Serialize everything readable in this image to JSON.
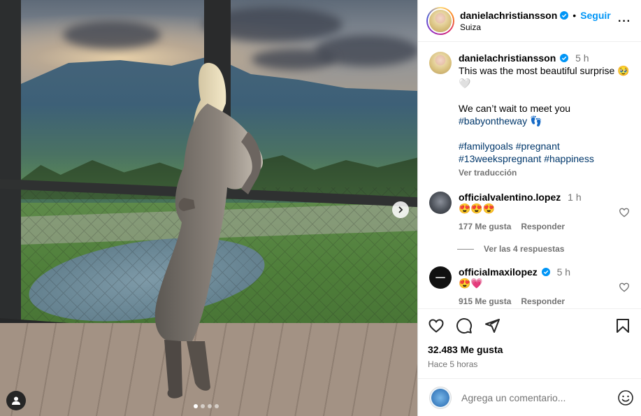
{
  "post": {
    "image_alt": "",
    "carousel_dots": 4,
    "active_dot": 0
  },
  "header": {
    "username": "danielachristiansson",
    "verified": true,
    "follow_label": "Seguir",
    "location": "Suiza",
    "more_icon": "more-horizontal-icon"
  },
  "caption": {
    "username": "danielachristiansson",
    "time": "5 h",
    "line1": "This was the most beautiful surprise 🥹",
    "line2": "🤍",
    "line3": "We can’t wait to meet you",
    "tag_line4": "#babyontheway",
    "line4_emoji": "👣",
    "tags_line5": [
      "#familygoals",
      "#pregnant"
    ],
    "tags_line6": [
      "#13weekspregnant",
      "#happiness"
    ],
    "translate_label": "Ver traducción"
  },
  "comments": [
    {
      "username": "officialvalentino.lopez",
      "verified": false,
      "time": "1 h",
      "text": "😍😍😍",
      "likes": "177 Me gusta",
      "reply_label": "Responder",
      "replies_label": "Ver las 4 respuestas"
    },
    {
      "username": "officialmaxilopez",
      "verified": true,
      "time": "5 h",
      "text": "😍💗",
      "likes": "915 Me gusta",
      "reply_label": "Responder"
    }
  ],
  "actions": {
    "likes": "32.483 Me gusta",
    "time_ago": "Hace 5 horas"
  },
  "add_comment": {
    "placeholder": "Agrega un comentario...",
    "emoji_icon": "emoji-icon"
  },
  "colors": {
    "link": "#00376b",
    "follow": "#0095f6",
    "muted": "#737373",
    "verified": "#0095f6"
  }
}
